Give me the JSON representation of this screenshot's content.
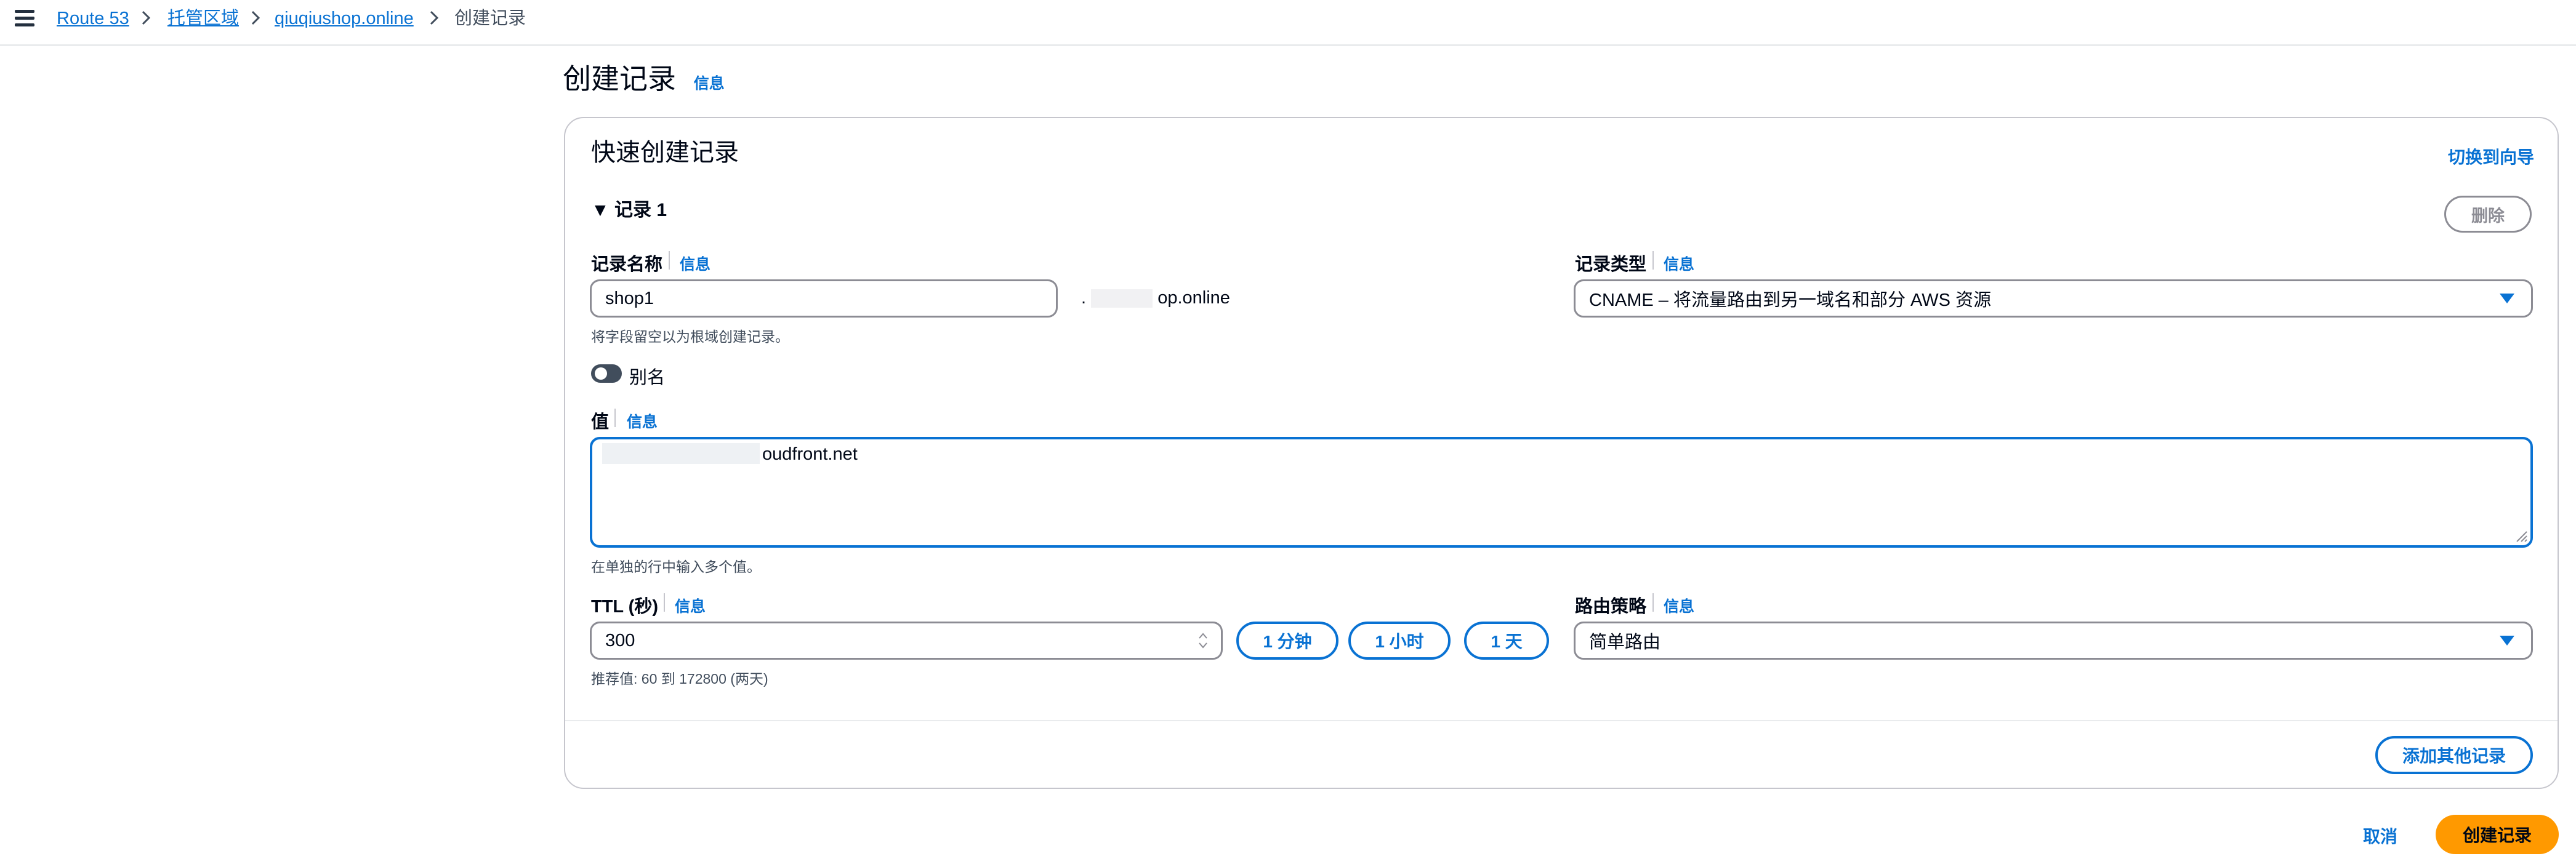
{
  "breadcrumb": {
    "items": [
      {
        "label": "Route 53"
      },
      {
        "label": "托管区域"
      },
      {
        "label": "qiuqiushop.online"
      },
      {
        "label": "创建记录"
      }
    ]
  },
  "page": {
    "title": "创建记录",
    "info": "信息"
  },
  "panel": {
    "heading": "快速创建记录",
    "switch_link": "切换到向导",
    "record_toggle": "▼ 记录 1",
    "delete_button": "删除",
    "add_record_button": "添加其他记录"
  },
  "record_name": {
    "label": "记录名称",
    "info": "信息",
    "value": "shop1",
    "domain_suffix_prefix": ".",
    "domain_suffix": "op.online",
    "hint": "将字段留空以为根域创建记录。"
  },
  "record_type": {
    "label": "记录类型",
    "info": "信息",
    "value": "CNAME – 将流量路由到另一域名和部分 AWS 资源"
  },
  "alias": {
    "label": "别名",
    "enabled": false
  },
  "value_field": {
    "label": "值",
    "info": "信息",
    "value": "oudfront.net",
    "hint": "在单独的行中输入多个值。"
  },
  "ttl": {
    "label": "TTL (秒)",
    "info": "信息",
    "value": "300",
    "hint": "推荐值: 60 到 172800 (两天)",
    "presets": [
      "1 分钟",
      "1 小时",
      "1 天"
    ]
  },
  "routing": {
    "label": "路由策略",
    "info": "信息",
    "value": "简单路由"
  },
  "footer": {
    "cancel": "取消",
    "submit": "创建记录"
  },
  "colors": {
    "accent": "#0972d3",
    "primary_button": "#ff9900",
    "text": "#000716"
  }
}
